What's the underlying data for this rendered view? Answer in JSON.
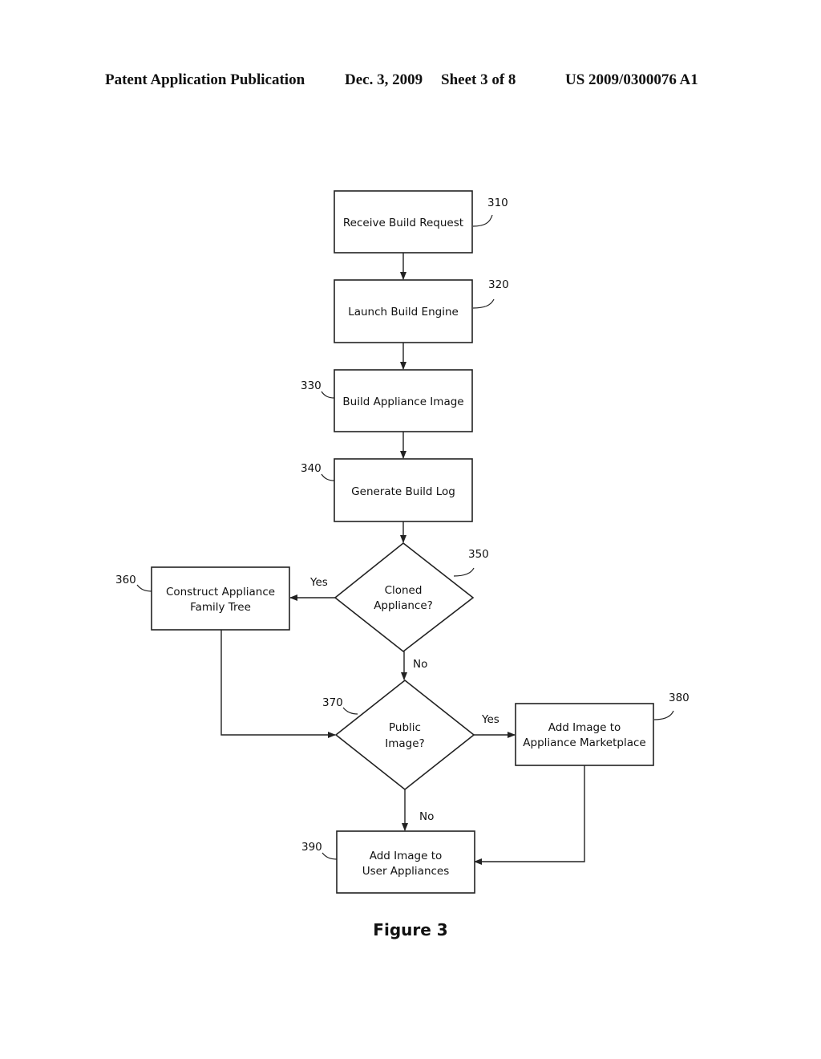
{
  "header": {
    "publication": "Patent Application Publication",
    "date": "Dec. 3, 2009",
    "sheet": "Sheet 3 of 8",
    "number": "US 2009/0300076 A1"
  },
  "diagram": {
    "nodes": [
      {
        "id": "310",
        "type": "process",
        "lines": [
          "Receive Build Request"
        ]
      },
      {
        "id": "320",
        "type": "process",
        "lines": [
          "Launch Build Engine"
        ]
      },
      {
        "id": "330",
        "type": "process",
        "lines": [
          "Build Appliance Image"
        ]
      },
      {
        "id": "340",
        "type": "process",
        "lines": [
          "Generate Build Log"
        ]
      },
      {
        "id": "350",
        "type": "decision",
        "lines": [
          "Cloned",
          "Appliance?"
        ]
      },
      {
        "id": "360",
        "type": "process",
        "lines": [
          "Construct Appliance",
          "Family Tree"
        ]
      },
      {
        "id": "370",
        "type": "decision",
        "lines": [
          "Public",
          "Image?"
        ]
      },
      {
        "id": "380",
        "type": "process",
        "lines": [
          "Add Image to",
          "Appliance Marketplace"
        ]
      },
      {
        "id": "390",
        "type": "process",
        "lines": [
          "Add Image to",
          "User Appliances"
        ]
      }
    ],
    "edges": [
      {
        "from": "310",
        "to": "320",
        "label": ""
      },
      {
        "from": "320",
        "to": "330",
        "label": ""
      },
      {
        "from": "330",
        "to": "340",
        "label": ""
      },
      {
        "from": "340",
        "to": "350",
        "label": ""
      },
      {
        "from": "350",
        "to": "360",
        "label": "Yes"
      },
      {
        "from": "350",
        "to": "370",
        "label": "No"
      },
      {
        "from": "360",
        "to": "370",
        "label": ""
      },
      {
        "from": "370",
        "to": "380",
        "label": "Yes"
      },
      {
        "from": "370",
        "to": "390",
        "label": "No"
      },
      {
        "from": "380",
        "to": "390",
        "label": ""
      }
    ],
    "caption": "Figure 3"
  }
}
